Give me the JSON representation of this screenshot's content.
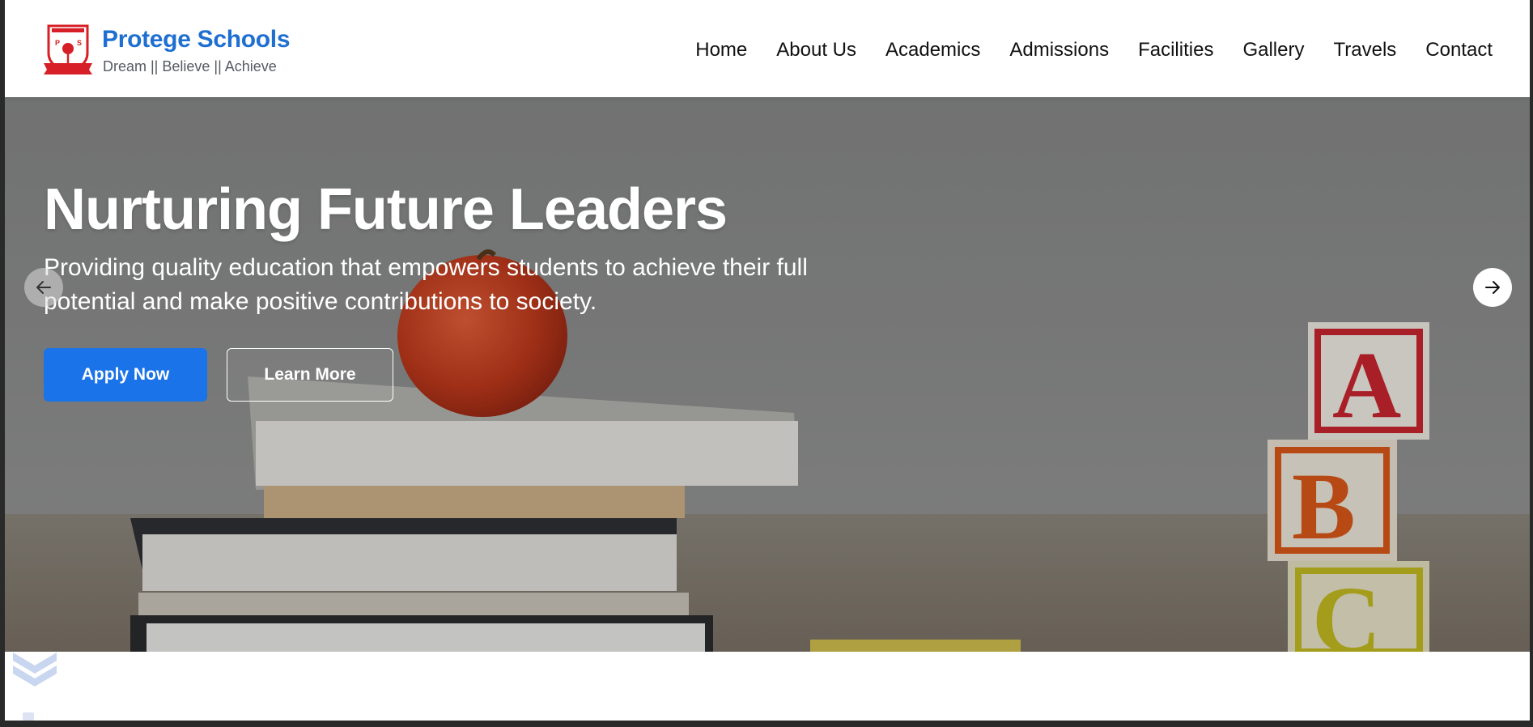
{
  "brand": {
    "name": "Protege Schools",
    "tagline": "Dream || Believe || Achieve",
    "logo_letters": "P I S"
  },
  "nav": {
    "items": [
      {
        "label": "Home"
      },
      {
        "label": "About Us"
      },
      {
        "label": "Academics"
      },
      {
        "label": "Admissions"
      },
      {
        "label": "Facilities"
      },
      {
        "label": "Gallery"
      },
      {
        "label": "Travels"
      },
      {
        "label": "Contact"
      }
    ]
  },
  "hero": {
    "title": "Nurturing Future Leaders",
    "subtitle": "Providing quality education that empowers students to achieve their full potential and make positive contributions to society.",
    "apply_label": "Apply Now",
    "learn_label": "Learn More"
  },
  "colors": {
    "brand_blue": "#1f6fd1",
    "button_blue": "#1a73e8",
    "logo_red": "#d61f26"
  },
  "icons": [
    "school-logo",
    "arrow-left-icon",
    "arrow-right-icon",
    "chevron-down-icon"
  ]
}
